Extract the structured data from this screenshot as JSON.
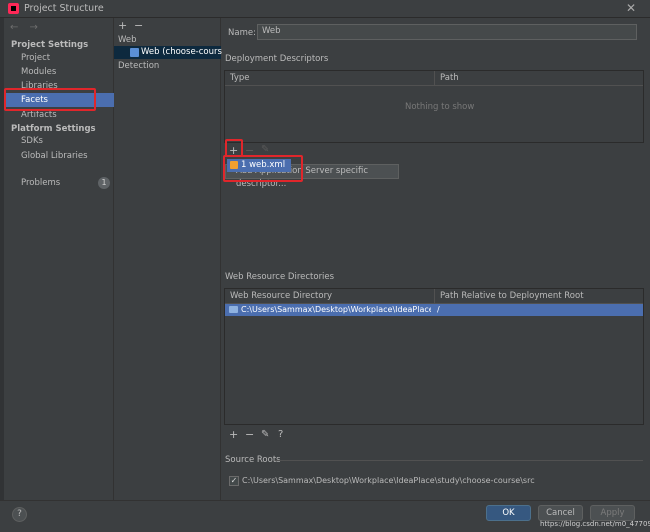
{
  "window": {
    "title": "Project Structure"
  },
  "nav": {
    "project_settings": "Project Settings",
    "items_project": [
      "Project",
      "Modules",
      "Libraries",
      "Facets",
      "Artifacts"
    ],
    "platform_settings": "Platform Settings",
    "items_platform": [
      "SDKs",
      "Global Libraries"
    ],
    "problems": "Problems",
    "problems_count": "1",
    "selected": "Facets"
  },
  "middle": {
    "add": "+",
    "remove": "−",
    "group": "Web",
    "facet": "Web (choose-course)",
    "detection": "Detection"
  },
  "right": {
    "name_label": "Name:",
    "name_value": "Web",
    "deployment": {
      "title": "Deployment Descriptors",
      "columns": [
        "Type",
        "Path"
      ],
      "empty_text": "Nothing to show",
      "popup_item": "1  web.xml",
      "popup_button": "Add Application Server specific descriptor..."
    },
    "resources": {
      "title": "Web Resource Directories",
      "columns": [
        "Web Resource Directory",
        "Path Relative to Deployment Root"
      ],
      "rows": [
        {
          "dir": "C:\\Users\\Sammax\\Desktop\\Workplace\\IdeaPlace\\st...",
          "rel": "/"
        }
      ]
    },
    "source_roots": {
      "title": "Source Roots",
      "checked": true,
      "path": "C:\\Users\\Sammax\\Desktop\\Workplace\\IdeaPlace\\study\\choose-course\\src"
    }
  },
  "footer": {
    "help": "?",
    "ok": "OK",
    "cancel": "Cancel",
    "apply": "Apply",
    "watermark": "https://blog.csdn.net/m0_47709146"
  },
  "colors": {
    "selection": "#4b6eaf",
    "highlight_box": "#e0262b",
    "ok_button": "#365880"
  }
}
